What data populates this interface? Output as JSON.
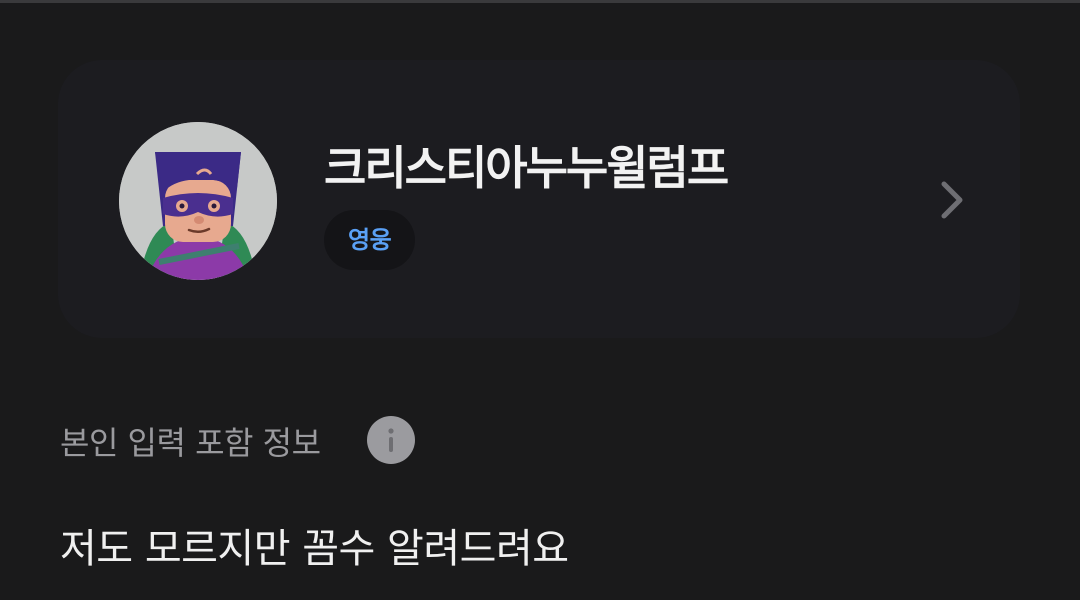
{
  "profile": {
    "nickname": "크리스티아누누윌럼프",
    "badge": "영웅",
    "avatar_icon": "avatar-character-icon",
    "chevron_icon": "chevron-right-icon"
  },
  "info_section": {
    "label": "본인 입력 포함 정보",
    "icon": "info-icon"
  },
  "answer": {
    "text": "저도 모르지만 꼼수 알려드려요"
  },
  "colors": {
    "background": "#1a1a1b",
    "card": "#1c1c20",
    "badge_text": "#5aa0f5",
    "label_text": "#9a9a9e"
  }
}
